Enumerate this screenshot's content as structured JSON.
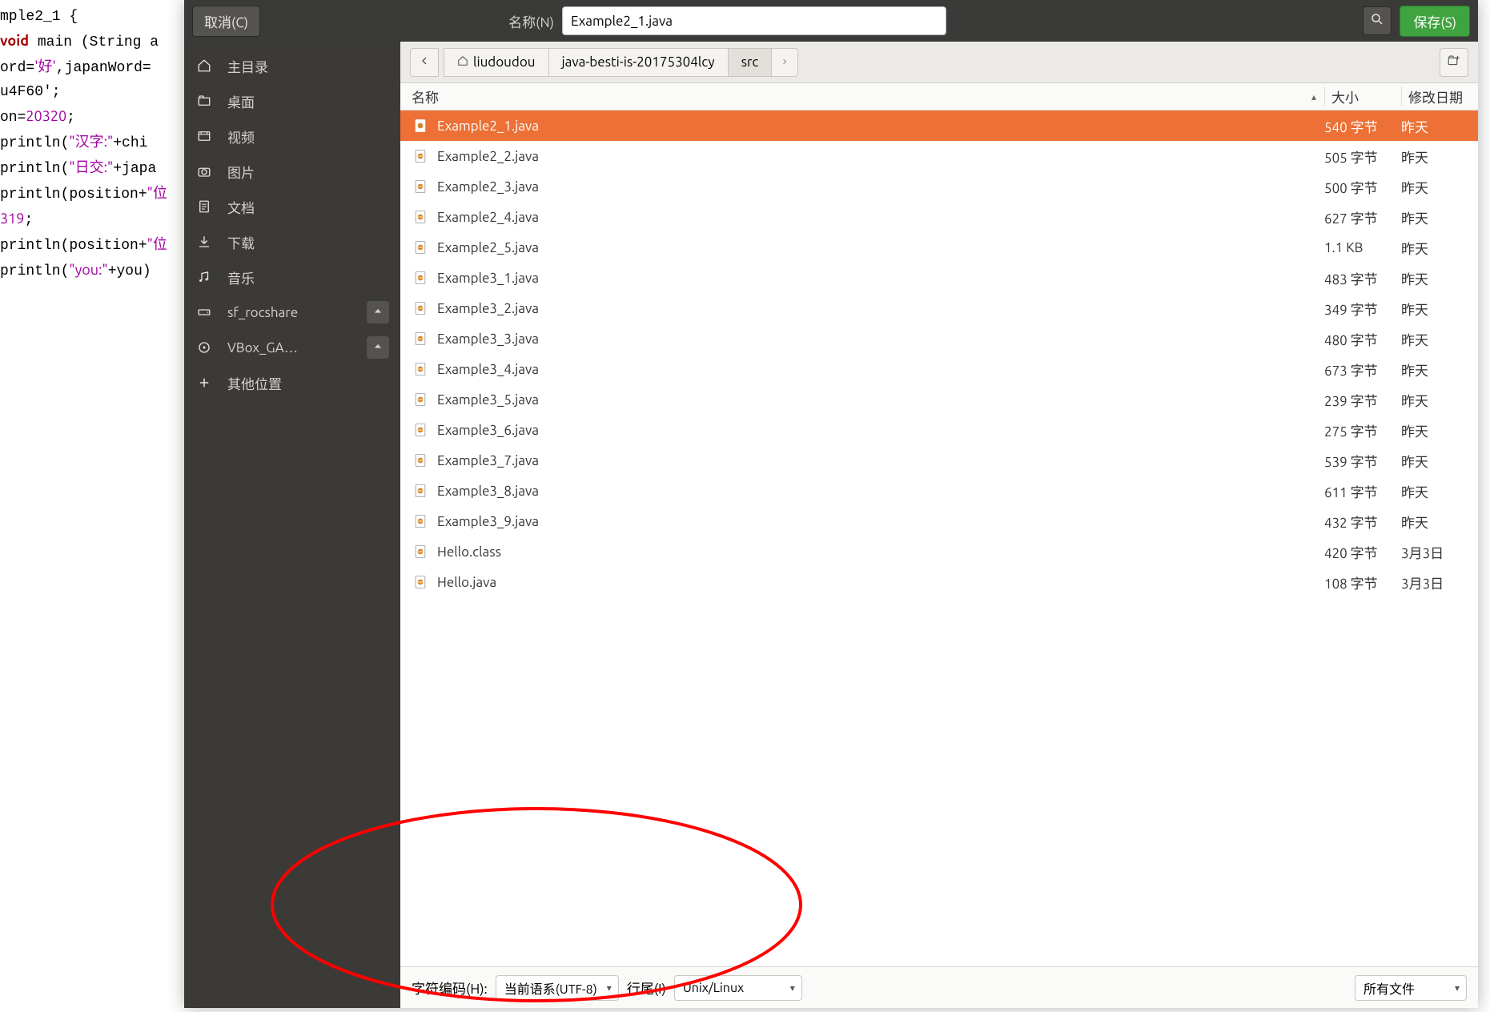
{
  "topbar": {
    "cancel": "取消(C)",
    "name_label": "名称(N)",
    "filename": "Example2_1.java",
    "save": "保存(S)"
  },
  "sidebar": {
    "items": [
      {
        "icon": "home",
        "label": "主目录"
      },
      {
        "icon": "folder",
        "label": "桌面"
      },
      {
        "icon": "video",
        "label": "视频"
      },
      {
        "icon": "camera",
        "label": "图片"
      },
      {
        "icon": "doc",
        "label": "文档"
      },
      {
        "icon": "download",
        "label": "下载"
      },
      {
        "icon": "music",
        "label": "音乐"
      },
      {
        "icon": "drive",
        "label": "sf_rocshare",
        "eject": true
      },
      {
        "icon": "disc",
        "label": "VBox_GA…",
        "eject": true
      },
      {
        "icon": "plus",
        "label": "其他位置"
      }
    ]
  },
  "breadcrumb": {
    "segments": [
      {
        "label": "liudoudou",
        "home": true
      },
      {
        "label": "java-besti-is-20175304lcy"
      },
      {
        "label": "src",
        "active": true
      }
    ]
  },
  "columns": {
    "name": "名称",
    "size": "大小",
    "modified": "修改日期"
  },
  "files": [
    {
      "name": "Example2_1.java",
      "size": "540 字节",
      "modified": "昨天",
      "selected": true
    },
    {
      "name": "Example2_2.java",
      "size": "505 字节",
      "modified": "昨天"
    },
    {
      "name": "Example2_3.java",
      "size": "500 字节",
      "modified": "昨天"
    },
    {
      "name": "Example2_4.java",
      "size": "627 字节",
      "modified": "昨天"
    },
    {
      "name": "Example2_5.java",
      "size": "1.1 KB",
      "modified": "昨天"
    },
    {
      "name": "Example3_1.java",
      "size": "483 字节",
      "modified": "昨天"
    },
    {
      "name": "Example3_2.java",
      "size": "349 字节",
      "modified": "昨天"
    },
    {
      "name": "Example3_3.java",
      "size": "480 字节",
      "modified": "昨天"
    },
    {
      "name": "Example3_4.java",
      "size": "673 字节",
      "modified": "昨天"
    },
    {
      "name": "Example3_5.java",
      "size": "239 字节",
      "modified": "昨天"
    },
    {
      "name": "Example3_6.java",
      "size": "275 字节",
      "modified": "昨天"
    },
    {
      "name": "Example3_7.java",
      "size": "539 字节",
      "modified": "昨天"
    },
    {
      "name": "Example3_8.java",
      "size": "611 字节",
      "modified": "昨天"
    },
    {
      "name": "Example3_9.java",
      "size": "432 字节",
      "modified": "昨天"
    },
    {
      "name": "Hello.class",
      "size": "420 字节",
      "modified": "3月3日"
    },
    {
      "name": "Hello.java",
      "size": "108 字节",
      "modified": "3月3日"
    }
  ],
  "bottom": {
    "enc_label": "字符编码(H):",
    "enc_value": "当前语系(UTF-8)",
    "eol_label": "行尾(I)",
    "eol_value": "Unix/Linux",
    "filter": "所有文件"
  },
  "code_lines": [
    {
      "t": "mple2_1 {"
    },
    {
      "t": "<kw>void</kw> main (String a"
    },
    {
      "t": "ord=<str>'好'</str>,japanWord="
    },
    {
      "t": "u4F60';"
    },
    {
      "t": "on=<num>20320</num>;"
    },
    {
      "t": "println(<str>\"汉字:\"</str>+chi"
    },
    {
      "t": "println(<str>\"日交:\"</str>+japa"
    },
    {
      "t": "println(position+<str>\"位</str>"
    },
    {
      "t": "<num>319</num>;"
    },
    {
      "t": "println(position+<str>\"位</str>"
    },
    {
      "t": "println(<str>\"you:\"</str>+you)"
    }
  ]
}
